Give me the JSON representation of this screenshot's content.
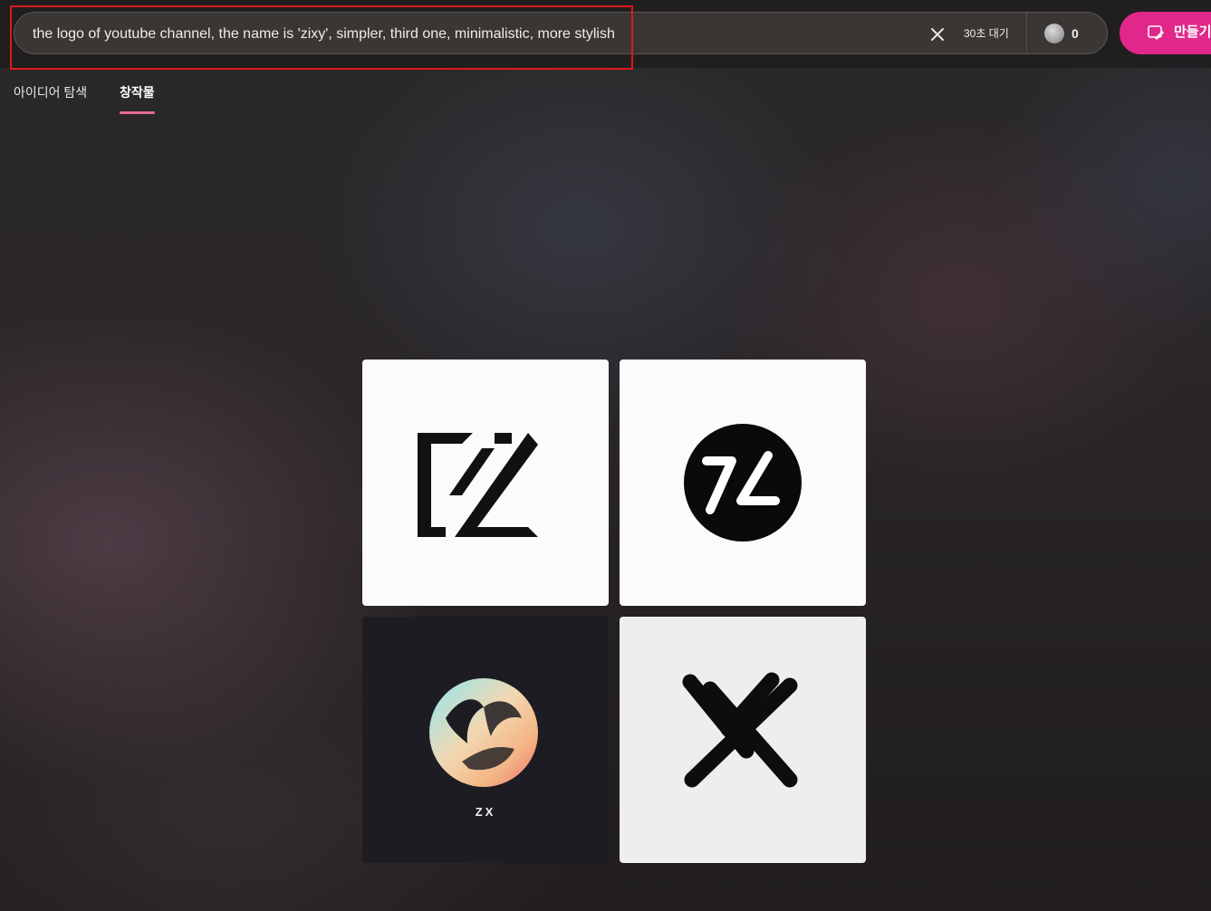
{
  "search": {
    "query": "the logo of youtube channel, the name is 'zixy', simpler, third one, minimalistic, more stylish",
    "wait_label": "30초 대기",
    "coin_count": "0"
  },
  "create_button": {
    "label": "만들기"
  },
  "tabs": [
    {
      "label": "아이디어 탐색",
      "active": false
    },
    {
      "label": "창작물",
      "active": true
    }
  ],
  "results": {
    "images": [
      {
        "icon": "zixy-logo-angular-z-icon"
      },
      {
        "icon": "zixy-logo-black-circle-7l-icon"
      },
      {
        "icon": "zixy-logo-gradient-circle-icon",
        "caption": "ZX"
      },
      {
        "icon": "zixy-logo-crossed-x-icon"
      }
    ]
  },
  "colors": {
    "accent": "#e1288a",
    "tab_underline": "#e46a93",
    "highlight_box": "#e01919"
  }
}
